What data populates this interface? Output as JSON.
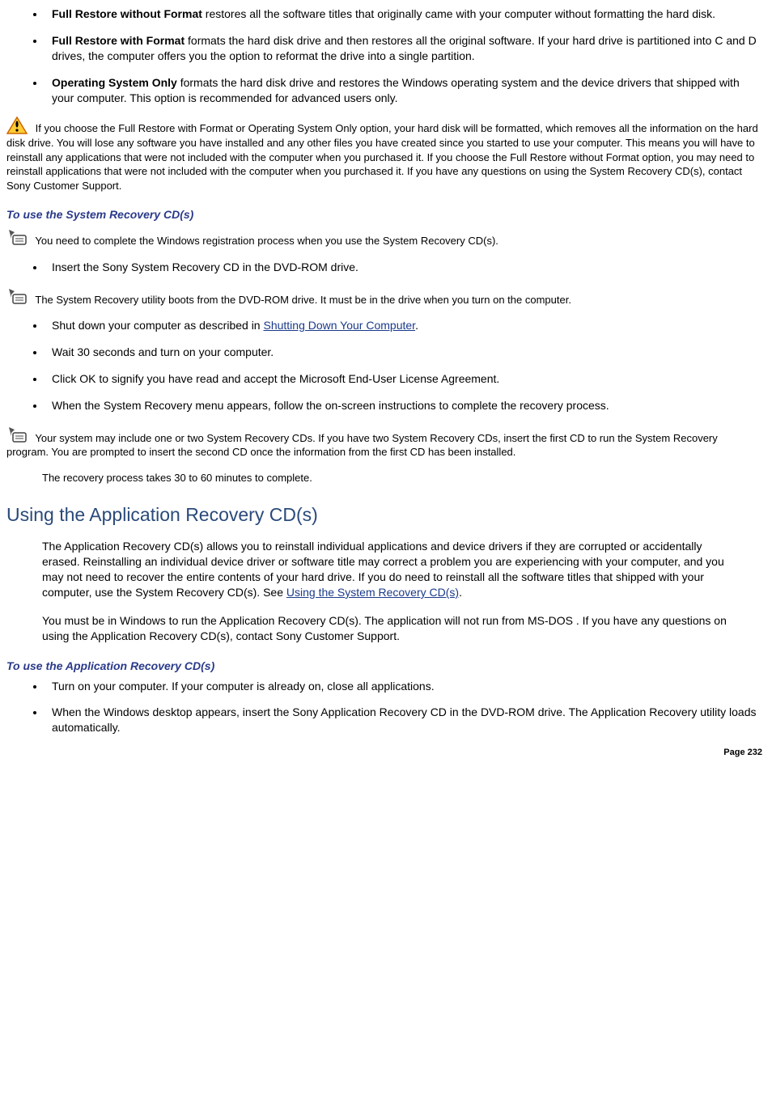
{
  "bullets_top": [
    {
      "term": "Full Restore without Format",
      "rest": " restores all the software titles that originally came with your computer without formatting the hard disk."
    },
    {
      "term": "Full Restore with Format",
      "rest": " formats the hard disk drive and then restores all the original software. If your hard drive is partitioned into C and D drives, the computer offers you the option to reformat the drive into a single partition."
    },
    {
      "term": "Operating System Only",
      "rest": " formats the hard disk drive and restores the Windows operating system and the device drivers that shipped with your computer. This option is recommended for advanced users only."
    }
  ],
  "caution_text": " If you choose the Full Restore with Format or Operating System Only option, your hard disk will be formatted, which removes all the information on the hard disk drive. You will lose any software you have installed and any other files you have created since you started to use your computer. This means you will have to reinstall any applications that were not included with the computer when you purchased it. If you choose the Full Restore without Format option, you may need to reinstall applications that were not included with the computer when you purchased it. If you have any questions on using the System Recovery CD(s), contact Sony Customer Support.",
  "heading_sys": "To use the System Recovery CD(s)",
  "note_reg": " You need to complete the Windows registration process when you use the System Recovery CD(s).",
  "step_insert": "Insert the Sony System Recovery CD in the DVD-ROM drive.",
  "note_boot": " The System Recovery utility boots from the DVD-ROM drive. It must be in the drive when you turn on the computer.",
  "steps_mid": {
    "shutdown_prefix": "Shut down your computer as described in ",
    "shutdown_link": "Shutting Down Your Computer",
    "shutdown_suffix": ".",
    "wait": "Wait 30 seconds and turn on your computer.",
    "ok": "Click OK to signify you have read and accept the Microsoft End-User License Agreement.",
    "menu": "When the System Recovery menu appears, follow the on-screen instructions to complete the recovery process."
  },
  "note_two_cds": " Your system may include one or two System Recovery CDs. If you have two System Recovery CDs, insert the first CD to run the System Recovery program. You are prompted to insert the second CD once the information from the first CD has been installed.",
  "recovery_time": "The recovery process takes 30 to 60 minutes to complete.",
  "h2_app": "Using the Application Recovery CD(s)",
  "app_para1_prefix": "The Application Recovery CD(s) allows you to reinstall individual applications and device drivers if they are corrupted or accidentally erased. Reinstalling an individual device driver or software title may correct a problem you are experiencing with your computer, and you may not need to recover the entire contents of your hard drive. If you do need to reinstall all the software titles that shipped with your computer, use the System Recovery CD(s). See ",
  "app_para1_link": "Using the System Recovery CD(s)",
  "app_para1_suffix": ".",
  "app_para2": "You must be in Windows to run the Application Recovery CD(s). The application will not run from MS-DOS  . If you have any questions on using the Application Recovery CD(s), contact Sony Customer Support.",
  "heading_app": "To use the Application Recovery CD(s)",
  "app_steps": [
    "Turn on your computer. If your computer is already on, close all applications.",
    "When the Windows desktop appears, insert the Sony Application Recovery CD in the DVD-ROM drive. The Application Recovery utility loads automatically."
  ],
  "page_num": "Page 232"
}
